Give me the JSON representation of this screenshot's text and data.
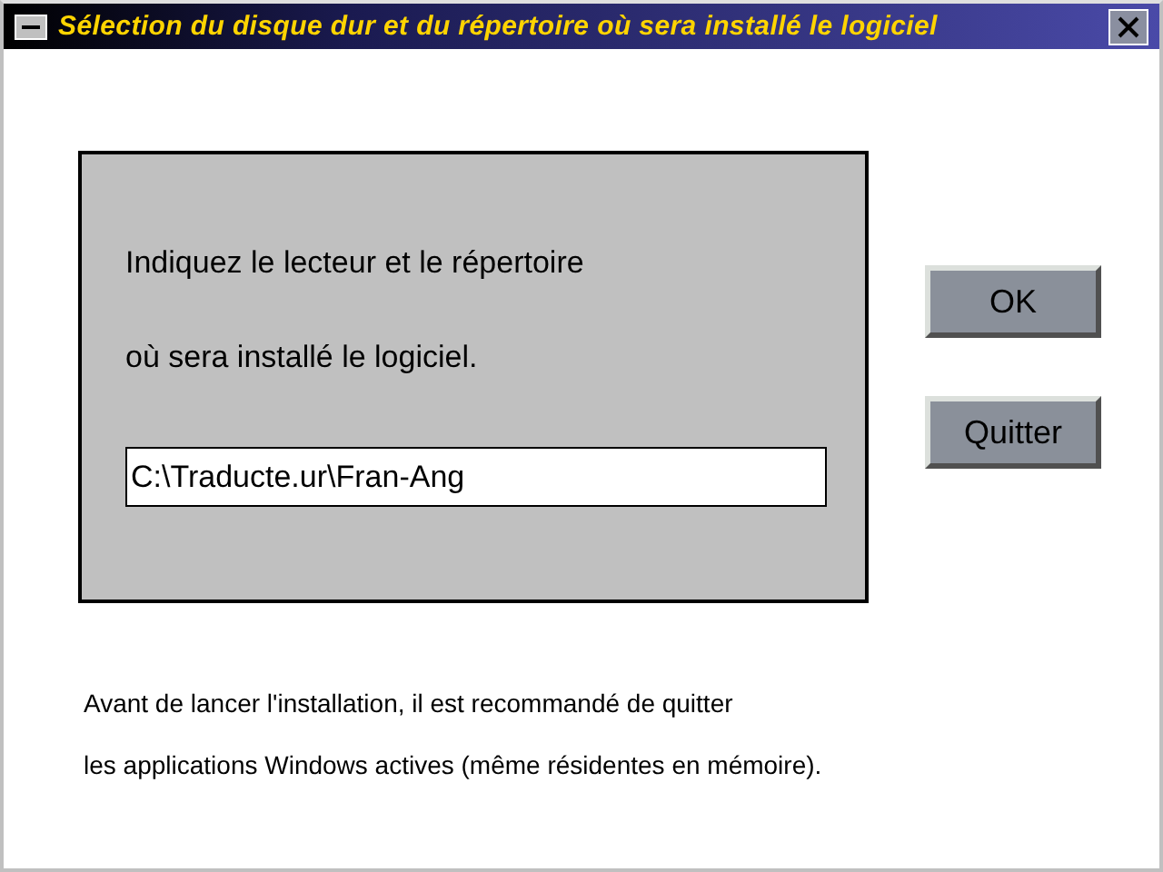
{
  "window": {
    "title": "Sélection du disque dur et du répertoire où sera installé le logiciel"
  },
  "panel": {
    "lines": [
      "Indiquez le lecteur et le répertoire",
      "où sera installé le logiciel."
    ],
    "path_field": {
      "value": "C:\\Traducte.ur\\Fran-Ang"
    }
  },
  "buttons": [
    "OK",
    "Quitter"
  ],
  "notice": [
    "Avant de lancer l'installation, il est recommandé de quitter",
    "les applications Windows actives (même résidentes en mémoire)."
  ]
}
